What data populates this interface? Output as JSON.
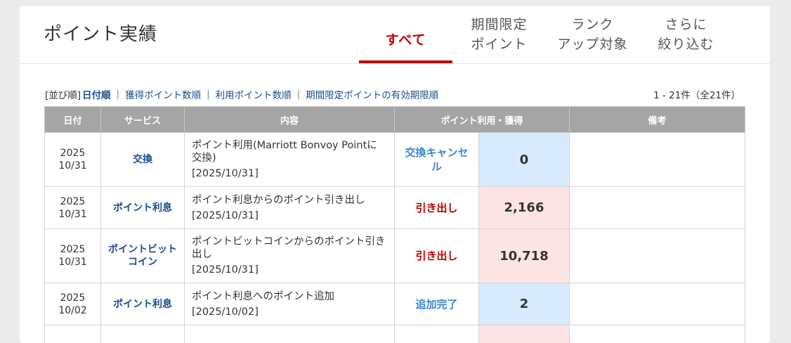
{
  "header": {
    "title": "ポイント実績",
    "tabs": [
      {
        "line1": "すべて",
        "line2": ""
      },
      {
        "line1": "期間限定",
        "line2": "ポイント"
      },
      {
        "line1": "ランク",
        "line2": "アップ対象"
      },
      {
        "line1": "さらに",
        "line2": "絞り込む"
      }
    ]
  },
  "sort": {
    "label": "[並び順]",
    "current": "日付順",
    "options": [
      "獲得ポイント数順",
      "利用ポイント数順",
      "期間限定ポイントの有効期限順"
    ],
    "separator": "|",
    "count": "1 - 21件（全21件）"
  },
  "table": {
    "headers": [
      "日付",
      "サービス",
      "内容",
      "ポイント利用・獲得",
      "備考"
    ],
    "rows": [
      {
        "year": "2025",
        "date": "10/31",
        "service": "交換",
        "content": "ポイント利用(Marriott Bonvoy Pointに交換)",
        "content_date": "[2025/10/31]",
        "action": "交換キャンセル",
        "action_color": "#3c87cf",
        "points": "0",
        "points_bg": "#d8eafd",
        "note": ""
      },
      {
        "year": "2025",
        "date": "10/31",
        "service": "ポイント利息",
        "content": "ポイント利息からのポイント引き出し",
        "content_date": "[2025/10/31]",
        "action": "引き出し",
        "action_color": "#bf0000",
        "points": "2,166",
        "points_bg": "#fde4e4",
        "note": ""
      },
      {
        "year": "2025",
        "date": "10/31",
        "service": "ポイントビットコイン",
        "content": "ポイントビットコインからのポイント引き出し",
        "content_date": "[2025/10/31]",
        "action": "引き出し",
        "action_color": "#bf0000",
        "points": "10,718",
        "points_bg": "#fde4e4",
        "note": ""
      },
      {
        "year": "2025",
        "date": "10/02",
        "service": "ポイント利息",
        "content": "ポイント利息へのポイント追加",
        "content_date": "[2025/10/02]",
        "action": "追加完了",
        "action_color": "#3c87cf",
        "points": "2",
        "points_bg": "#d8eafd",
        "note": ""
      }
    ]
  }
}
